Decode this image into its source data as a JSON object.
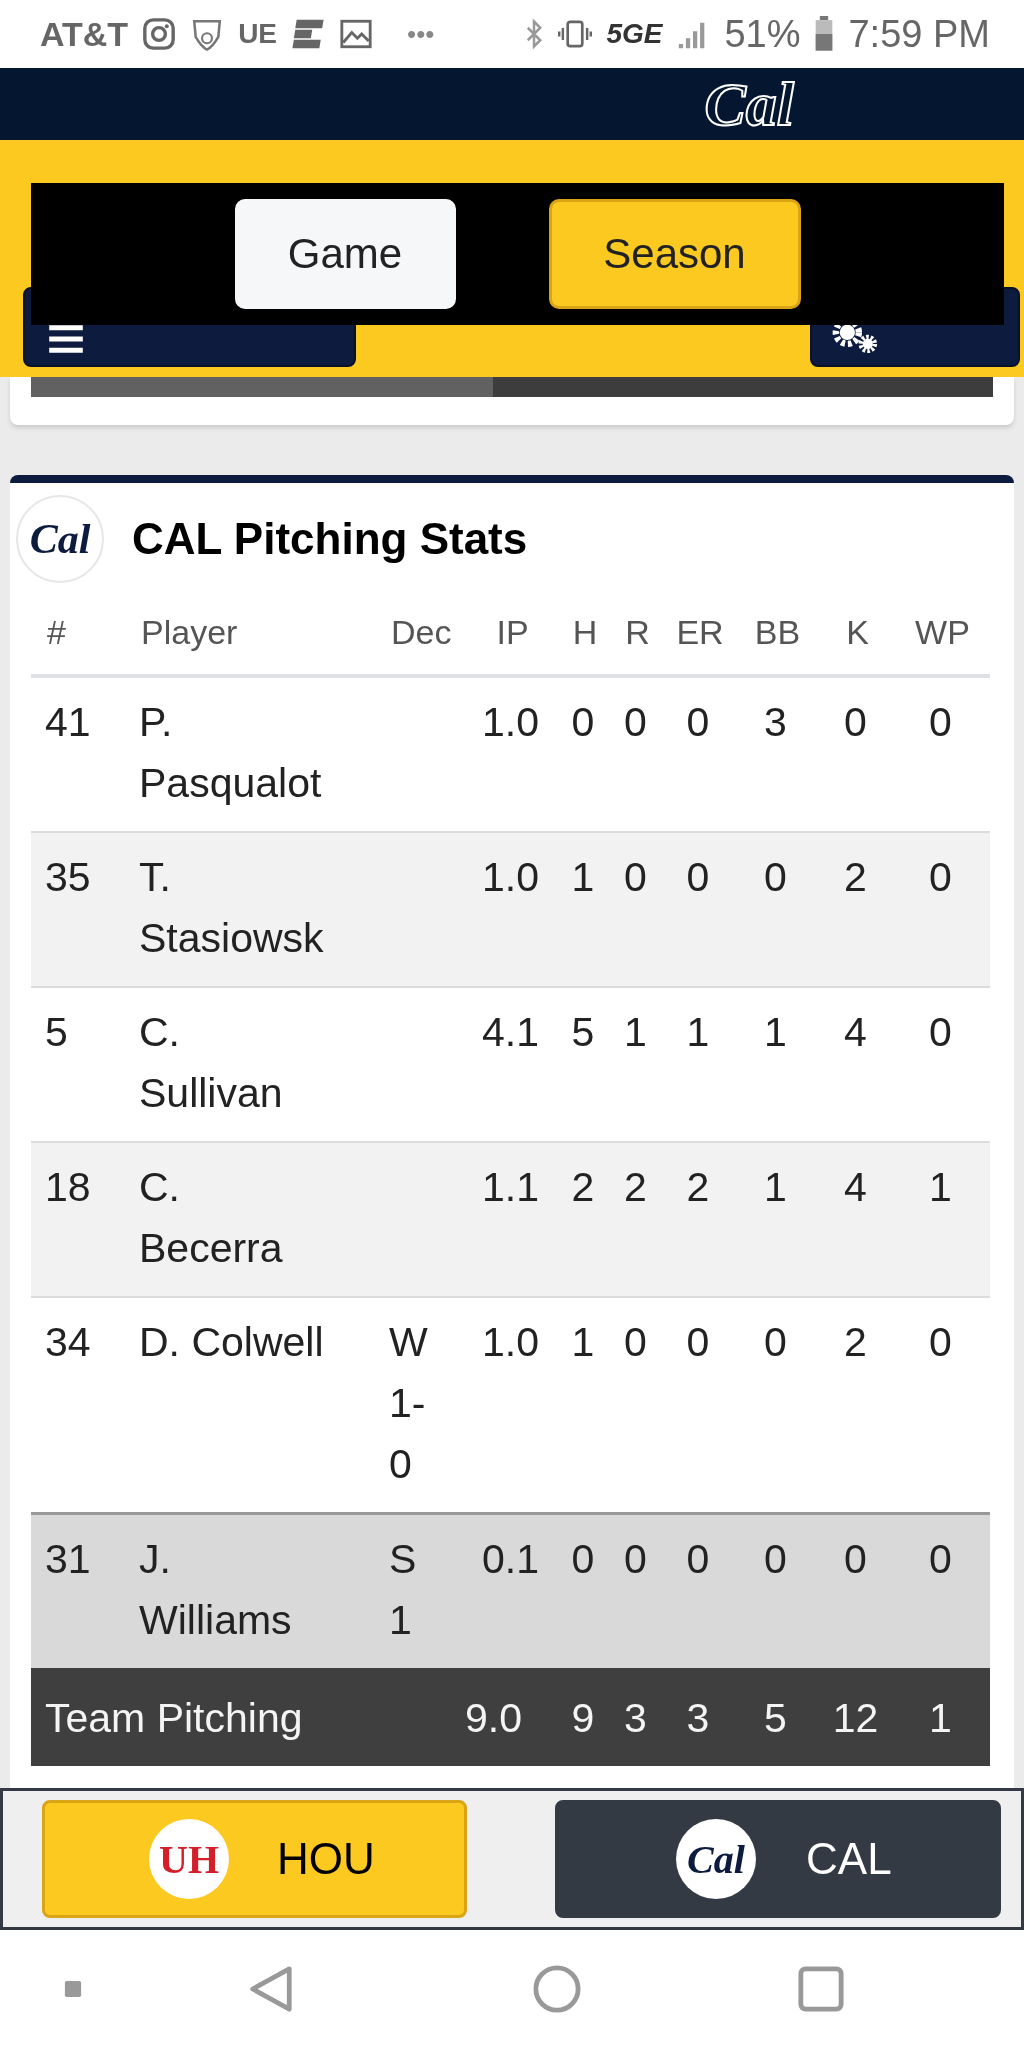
{
  "status_bar": {
    "carrier": "AT&T",
    "app_label": "UE",
    "more": "•••",
    "network": "5GE",
    "battery": "51%",
    "time": "7:59 PM"
  },
  "header": {
    "logo": "Cal"
  },
  "view_toggle": [
    {
      "label": "Game",
      "selected": false
    },
    {
      "label": "Season",
      "selected": true
    }
  ],
  "progress": {
    "level": 0.48
  },
  "stats": {
    "logo": "Cal",
    "title": "CAL Pitching Stats",
    "columns": [
      "#",
      "Player",
      "Dec",
      "IP",
      "H",
      "R",
      "ER",
      "BB",
      "K",
      "WP"
    ],
    "rows": [
      {
        "number": "41",
        "player": "P. Pasqualot",
        "ip": "1.0",
        "h": "0",
        "r": "0",
        "er": "0",
        "bb": "3",
        "k": "0",
        "wp": "0",
        "highlighted": false
      },
      {
        "number": "35",
        "player": "T. Stasiowsk",
        "ip": "1.0",
        "h": "1",
        "r": "0",
        "er": "0",
        "bb": "0",
        "k": "2",
        "wp": "0",
        "highlighted": false
      },
      {
        "number": "5",
        "player": "C. Sullivan",
        "ip": "4.1",
        "h": "5",
        "r": "1",
        "er": "1",
        "bb": "1",
        "k": "4",
        "wp": "0",
        "highlighted": false
      },
      {
        "number": "18",
        "player": "C. Becerra",
        "ip": "1.1",
        "h": "2",
        "r": "2",
        "er": "2",
        "bb": "1",
        "k": "4",
        "wp": "1",
        "highlighted": false
      },
      {
        "number": "34",
        "player": "D. Colwell",
        "dec": "W 1-0",
        "ip": "1.0",
        "h": "1",
        "r": "0",
        "er": "0",
        "bb": "0",
        "k": "2",
        "wp": "0",
        "highlighted": false
      },
      {
        "number": "31",
        "player": "J. Williams",
        "dec": "S 1",
        "ip": "0.1",
        "h": "0",
        "r": "0",
        "er": "0",
        "bb": "0",
        "k": "0",
        "wp": "0",
        "highlighted": true
      }
    ],
    "totals": {
      "label": "Team Pitching",
      "ip": "9.0",
      "h": "9",
      "r": "3",
      "er": "3",
      "bb": "5",
      "k": "12",
      "wp": "1"
    }
  },
  "team_tabs": [
    {
      "logo": "UH",
      "label": "HOU",
      "selected": true
    },
    {
      "logo": "Cal",
      "label": "CAL",
      "selected": false
    }
  ]
}
